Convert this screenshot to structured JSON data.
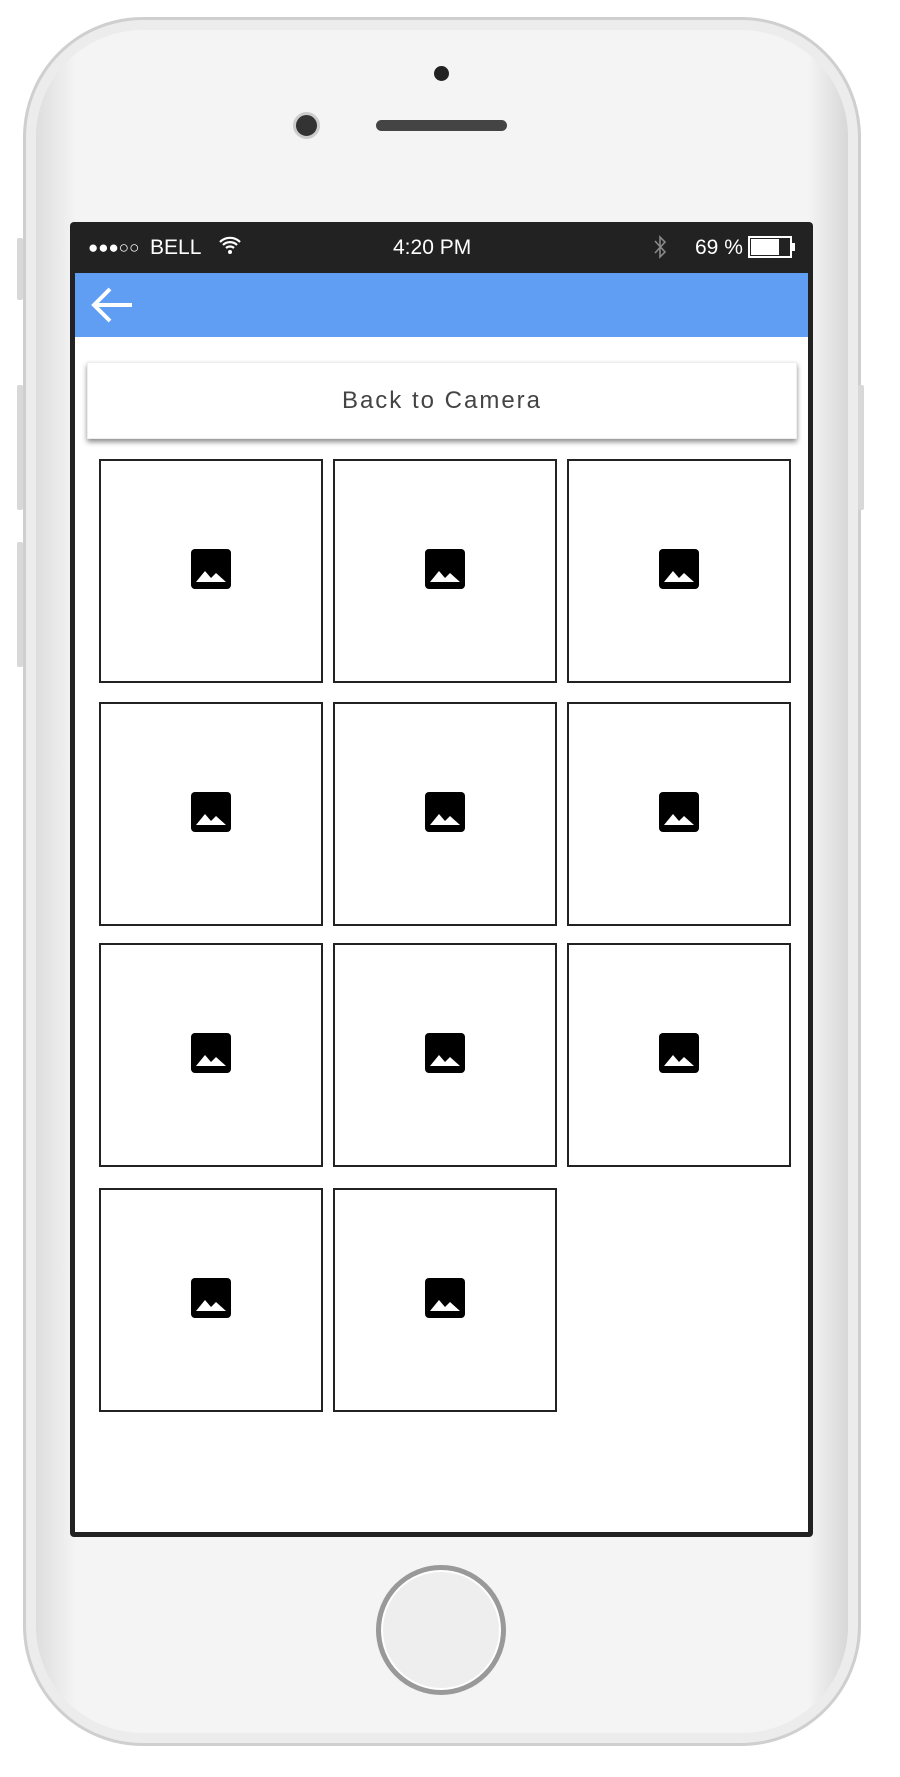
{
  "status_bar": {
    "signal": "●●●○○",
    "carrier": "BELL",
    "time": "4:20 PM",
    "battery": "69 %"
  },
  "header": {
    "back_icon": "arrow-left-icon",
    "color": "#5f9ef2"
  },
  "back_to_camera_label": "Back to Camera",
  "gallery": {
    "count": 11,
    "thumbnail_icon": "image-icon"
  }
}
